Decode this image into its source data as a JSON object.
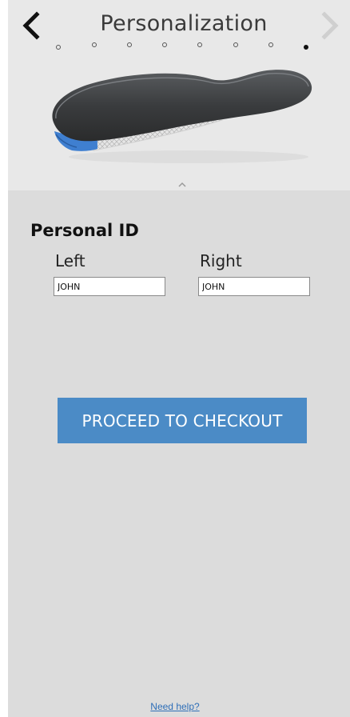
{
  "header": {
    "title": "Personalization",
    "back_icon": "chevron-left-icon",
    "forward_icon": "chevron-right-icon",
    "step_count": 8,
    "active_step": 8
  },
  "product": {
    "image_icon": "insole-image",
    "collapse_icon": "chevron-up-icon"
  },
  "personal_id": {
    "title": "Personal ID",
    "left_label": "Left",
    "right_label": "Right",
    "left_value": "JOHN",
    "right_value": "JOHN"
  },
  "checkout": {
    "label": "PROCEED TO CHECKOUT"
  },
  "footer": {
    "help_label": "Need help?"
  },
  "colors": {
    "accent": "#4b8bc6",
    "top_panel": "#e8e8e8",
    "bottom_panel": "#dcdcdc",
    "link": "#2f6fb8"
  }
}
